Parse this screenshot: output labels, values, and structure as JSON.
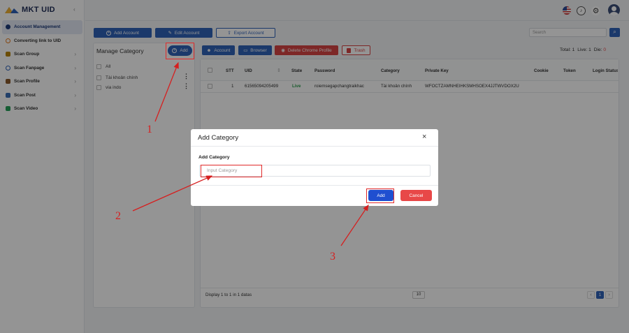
{
  "app": {
    "name": "MKT UID",
    "collapse_icon": "chevron-left-icon"
  },
  "sidebar": {
    "items": [
      {
        "label": "Account Management",
        "icon": "user-circle-icon",
        "color": "#203d7a",
        "active": true,
        "arrow": false
      },
      {
        "label": "Converting link to UID",
        "icon": "refresh-icon",
        "color": "#e67e22",
        "arrow": false
      },
      {
        "label": "Scan Group",
        "icon": "group-icon",
        "color": "#b8860b",
        "arrow": true
      },
      {
        "label": "Scan Fanpage",
        "icon": "search-icon",
        "color": "#2f62b8",
        "arrow": true
      },
      {
        "label": "Scan Profile",
        "icon": "profile-icon",
        "color": "#8b5a2b",
        "arrow": true
      },
      {
        "label": "Scan Post",
        "icon": "post-icon",
        "color": "#3b6fb6",
        "arrow": true
      },
      {
        "label": "Scan Video",
        "icon": "video-icon",
        "color": "#27a05a",
        "arrow": true
      }
    ]
  },
  "toolbar": {
    "add_account": "Add Account",
    "edit_account": "Edit Account",
    "export_account": "Export Account",
    "search_placeholder": "Search"
  },
  "category_panel": {
    "title": "Manage Category",
    "add_label": "Add",
    "items": [
      "All",
      "Tài khoản chính",
      "via indo"
    ]
  },
  "actions": {
    "account": "Account",
    "browser": "Browser",
    "delete_chrome": "Delete Chrome Profile",
    "trash": "Trash"
  },
  "stats": {
    "total_label": "Total:",
    "total": "1",
    "live_label": "Live:",
    "live": "1",
    "die_label": "Die:",
    "die": "0"
  },
  "table": {
    "headers": [
      "STT",
      "UID",
      "State",
      "Password",
      "Category",
      "Private Key",
      "Cookie",
      "Token",
      "Login Status"
    ],
    "rows": [
      {
        "stt": "1",
        "uid": "61565094205499",
        "state": "Live",
        "password": "roiemsegapchangtraikhac",
        "category": "Tài khoản chính",
        "private_key": "WFOCTZAMNHEIHKSMHSOEX4JJTWVDOX2U",
        "cookie": "",
        "token": "",
        "login_status": ""
      }
    ],
    "footer": "Display 1 to 1 in 1 datas",
    "page_size": "10",
    "current_page": "1",
    "prev": "‹",
    "next": "›"
  },
  "modal": {
    "title": "Add Category",
    "field_label": "Add Category",
    "placeholder": "Input Category",
    "add": "Add",
    "cancel": "Cancel",
    "close": "×"
  },
  "annotations": {
    "one": "1",
    "two": "2",
    "three": "3"
  },
  "colors": {
    "primary": "#2f62b8",
    "danger": "#e84848",
    "live": "#2e9e4f",
    "annotation": "#d61f1f"
  }
}
